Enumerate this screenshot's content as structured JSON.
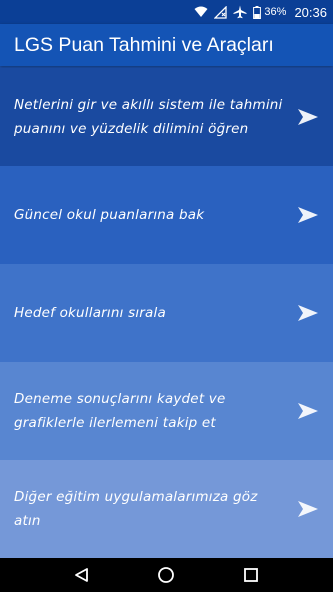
{
  "statusbar": {
    "battery_percent": "36%",
    "clock": "20:36",
    "icons": [
      "wifi-icon",
      "no-signal-icon",
      "airplane-icon",
      "battery-icon"
    ]
  },
  "appbar": {
    "title": "LGS Puan Tahmini ve Araçları"
  },
  "menu": {
    "items": [
      {
        "label": "Netlerini gir ve akıllı sistem ile tahmini puanını ve  yüzdelik dilimini öğren",
        "color": "#1a4aa0",
        "icon": "arrow-right-icon"
      },
      {
        "label": "Güncel okul puanlarına bak",
        "color": "#2a61bf",
        "icon": "arrow-right-icon"
      },
      {
        "label": "Hedef okullarını sırala",
        "color": "#3f73c9",
        "icon": "arrow-right-icon"
      },
      {
        "label": "Deneme sonuçlarını kaydet ve grafiklerle ilerlemeni takip et",
        "color": "#5886d1",
        "icon": "arrow-right-icon"
      },
      {
        "label": "Diğer eğitim uygulamalarımıza göz atın",
        "color": "#7598d8",
        "icon": "arrow-right-icon"
      }
    ]
  },
  "navbar": {
    "icons": [
      "back-icon",
      "home-icon",
      "recents-icon"
    ]
  }
}
